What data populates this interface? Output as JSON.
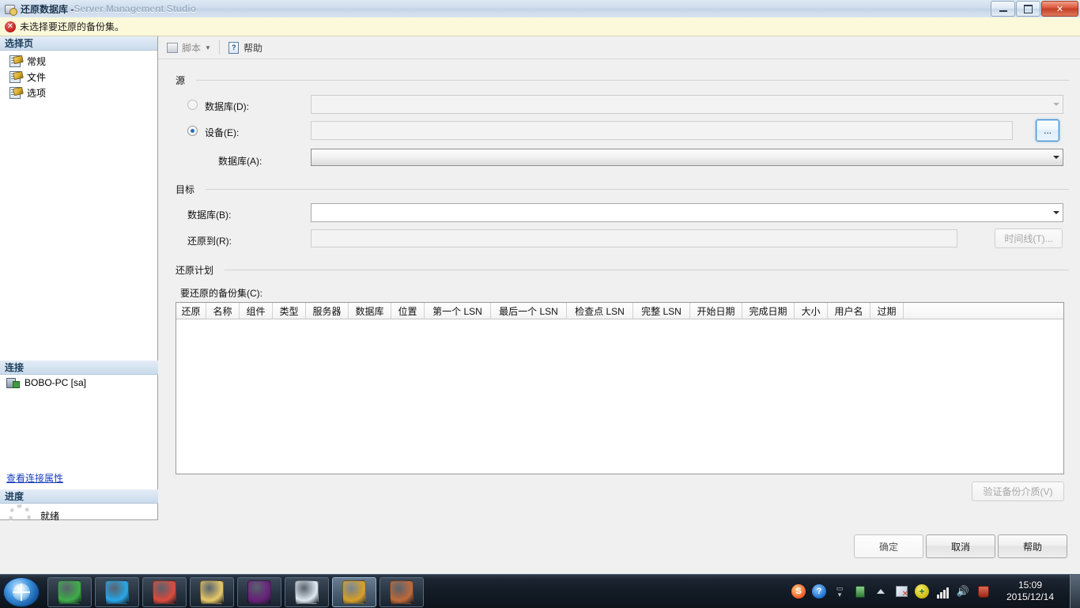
{
  "window": {
    "title": "还原数据库 - ",
    "title_dim": "Server Management Studio",
    "icon": "restore-database-icon",
    "buttons": {
      "minimize": "─",
      "maximize": "❐",
      "close": "✕"
    }
  },
  "error_banner": {
    "icon": "error-icon",
    "glyph": "✕",
    "message": "未选择要还原的备份集。"
  },
  "sidebar": {
    "select_page_header": "选择页",
    "items": [
      {
        "label": "常规",
        "icon": "page-script-icon"
      },
      {
        "label": "文件",
        "icon": "page-script-icon"
      },
      {
        "label": "选项",
        "icon": "page-script-icon"
      }
    ],
    "connection_header": "连接",
    "server": "BOBO-PC [sa]",
    "server_icon": "server-connection-icon",
    "view_connection_link": "查看连接属性",
    "progress_header": "进度",
    "progress_status": "就绪",
    "progress_icon": "spinner-icon"
  },
  "toolbar": {
    "script_label": "脚本",
    "script_icon": "script-icon",
    "script_caret": "▼",
    "help_label": "帮助",
    "help_icon": "help-icon"
  },
  "source": {
    "group_title": "源",
    "database_radio_label": "数据库(D):",
    "database_radio_selected": false,
    "database_value": "",
    "device_radio_label": "设备(E):",
    "device_radio_selected": true,
    "device_value": "",
    "browse_button": "...",
    "source_db_label": "数据库(A):",
    "source_db_value": ""
  },
  "destination": {
    "group_title": "目标",
    "database_label": "数据库(B):",
    "database_value": "",
    "restore_to_label": "还原到(R):",
    "restore_to_value": "",
    "timeline_button": "时间线(T)..."
  },
  "restore_plan": {
    "group_title": "还原计划",
    "backup_sets_label": "要还原的备份集(C):",
    "columns": [
      {
        "label": "还原",
        "width": 38
      },
      {
        "label": "名称",
        "width": 42
      },
      {
        "label": "组件",
        "width": 42
      },
      {
        "label": "类型",
        "width": 42
      },
      {
        "label": "服务器",
        "width": 54
      },
      {
        "label": "数据库",
        "width": 54
      },
      {
        "label": "位置",
        "width": 42
      },
      {
        "label": "第一个 LSN",
        "width": 84
      },
      {
        "label": "最后一个 LSN",
        "width": 96
      },
      {
        "label": "检查点 LSN",
        "width": 84
      },
      {
        "label": "完整 LSN",
        "width": 72
      },
      {
        "label": "开始日期",
        "width": 66
      },
      {
        "label": "完成日期",
        "width": 66
      },
      {
        "label": "大小",
        "width": 42
      },
      {
        "label": "用户名",
        "width": 54
      },
      {
        "label": "过期",
        "width": 42
      }
    ],
    "rows": [],
    "verify_button": "验证备份介质(V)"
  },
  "footer": {
    "ok_button": "确定",
    "cancel_button": "取消",
    "help_button": "帮助"
  },
  "taskbar": {
    "start_icon": "windows-start-orb-icon",
    "apps": [
      {
        "name": "browser-360-icon",
        "color": "#3fae4a"
      },
      {
        "name": "qq-messenger-icon",
        "color": "#29a7e8"
      },
      {
        "name": "chrome-icon",
        "color": "#dd4b3e"
      },
      {
        "name": "file-explorer-icon",
        "color": "#e8c96a"
      },
      {
        "name": "visual-studio-icon",
        "color": "#68217a"
      },
      {
        "name": "notepad-icon",
        "color": "#dfe9f2"
      },
      {
        "name": "sql-server-management-studio-icon",
        "color": "#d8a128"
      },
      {
        "name": "paint-icon",
        "color": "#c06a3a"
      }
    ],
    "tray": [
      {
        "name": "sogou-input-icon",
        "glyph": "S",
        "color": "#f15a22"
      },
      {
        "name": "help-question-icon",
        "glyph": "?",
        "color": "#1c6fd0"
      },
      {
        "name": "expand-tray-icon",
        "glyph": "▴",
        "color": "#cfd8e2"
      },
      {
        "name": "usb-device-icon",
        "glyph": "",
        "color": "#4caf50"
      },
      {
        "name": "show-hidden-icons-icon",
        "glyph": "▴",
        "color": "#cfd8e2"
      },
      {
        "name": "network-flag-icon",
        "glyph": "",
        "color": "#d64a3a"
      },
      {
        "name": "360-safe-icon",
        "glyph": "+",
        "color": "#d9d316"
      },
      {
        "name": "signal-bars-icon",
        "glyph": "",
        "color": "#e4e4e4"
      },
      {
        "name": "volume-icon",
        "glyph": "🔊",
        "color": "#e4e4e4"
      },
      {
        "name": "antivirus-icon",
        "glyph": "",
        "color": "#c0392b"
      }
    ],
    "clock_time": "15:09",
    "clock_date": "2015/12/14"
  },
  "colors": {
    "accent": "#2a6fb5",
    "error": "#c21d1d",
    "banner_bg": "#fbf9da",
    "panel_header": "#c9dbec"
  }
}
